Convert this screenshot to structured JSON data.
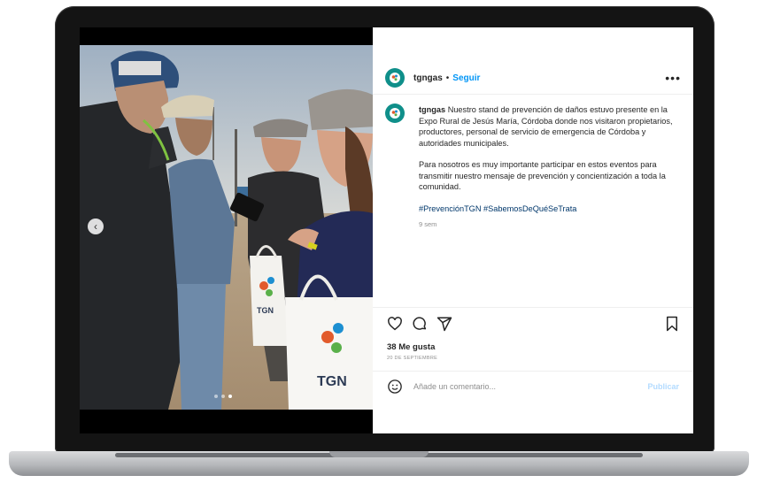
{
  "post": {
    "username": "tgngas",
    "separator": "•",
    "follow_label": "Seguir",
    "more_label": "•••",
    "caption_username": "tgngas",
    "caption_p1": "Nuestro stand de prevención de daños estuvo presente en la Expo Rural de Jesús María, Córdoba donde nos visitaron propietarios, productores, personal de servicio de emergencia de Córdoba y autoridades municipales.",
    "caption_p2": "Para nosotros es muy importante participar en estos eventos para transmitir nuestro mensaje de prevención y concientización a toda la comunidad.",
    "hashtags": "#PrevenciónTGN #SabemosDeQuéSeTrata",
    "time_ago": "9 sem",
    "likes": "38 Me gusta",
    "date": "20 DE SEPTIEMBRE",
    "comment_placeholder": "Añade un comentario...",
    "publish_label": "Publicar"
  },
  "carousel": {
    "prev_glyph": "‹",
    "dots": 3,
    "active_dot": 2
  },
  "photo": {
    "bag_logo_text": "TGN"
  },
  "icons": {
    "like": "heart-icon",
    "comment": "comment-icon",
    "share": "share-icon",
    "save": "bookmark-icon",
    "emoji": "emoji-icon",
    "more": "more-icon",
    "prev": "chevron-left-icon"
  },
  "colors": {
    "link": "#0095f6",
    "brand_teal": "#0f8f8a",
    "publish_disabled": "#b3dbff",
    "hashtag": "#00376b"
  }
}
